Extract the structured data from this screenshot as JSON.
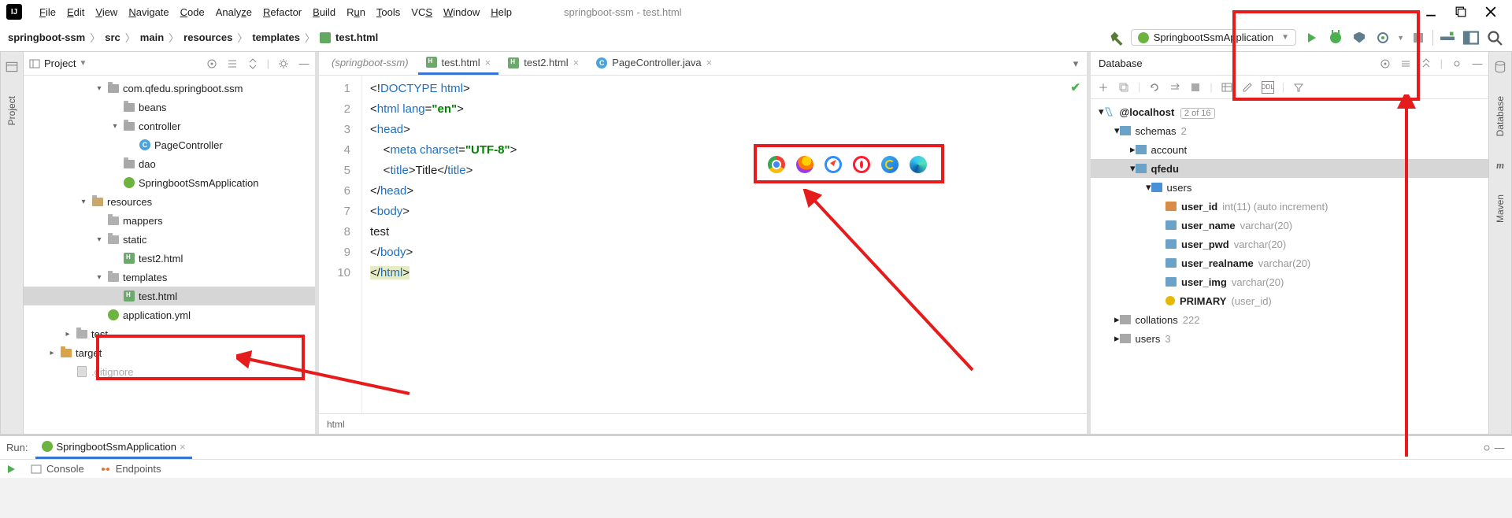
{
  "window": {
    "title": "springboot-ssm - test.html",
    "menus": [
      {
        "u": "F",
        "rest": "ile"
      },
      {
        "u": "E",
        "rest": "dit"
      },
      {
        "u": "V",
        "rest": "iew"
      },
      {
        "u": "N",
        "rest": "avigate"
      },
      {
        "u": "C",
        "rest": "ode"
      },
      {
        "u": "",
        "rest": "Analyze"
      },
      {
        "u": "R",
        "rest": "efactor"
      },
      {
        "u": "B",
        "rest": "uild"
      },
      {
        "u": "",
        "rest": "R"
      },
      {
        "u": "T",
        "rest": "ools"
      },
      {
        "u": "",
        "rest": "VCS"
      },
      {
        "u": "W",
        "rest": "indow"
      },
      {
        "u": "H",
        "rest": "elp"
      }
    ],
    "menus_raw": [
      "File",
      "Edit",
      "View",
      "Navigate",
      "Code",
      "Analyze",
      "Refactor",
      "Build",
      "Run",
      "Tools",
      "VCS",
      "Window",
      "Help"
    ]
  },
  "breadcrumb": [
    "springboot-ssm",
    "src",
    "main",
    "resources",
    "templates",
    "test.html"
  ],
  "runconfig_label": "SpringbootSsmApplication",
  "project_panel": {
    "title": "Project"
  },
  "tree": [
    {
      "ind": 90,
      "chev": "▾",
      "icon": "pkg",
      "label": "com.qfedu.springboot.ssm"
    },
    {
      "ind": 110,
      "chev": "",
      "icon": "pkg",
      "label": "beans"
    },
    {
      "ind": 110,
      "chev": "▾",
      "icon": "pkg",
      "label": "controller"
    },
    {
      "ind": 130,
      "chev": "",
      "icon": "cls",
      "label": "PageController"
    },
    {
      "ind": 110,
      "chev": "",
      "icon": "pkg",
      "label": "dao"
    },
    {
      "ind": 110,
      "chev": "",
      "icon": "leaf",
      "label": "SpringbootSsmApplication"
    },
    {
      "ind": 70,
      "chev": "▾",
      "icon": "res",
      "label": "resources"
    },
    {
      "ind": 90,
      "chev": "",
      "icon": "folder",
      "label": "mappers"
    },
    {
      "ind": 90,
      "chev": "▾",
      "icon": "folder",
      "label": "static"
    },
    {
      "ind": 110,
      "chev": "",
      "icon": "html",
      "label": "test2.html"
    },
    {
      "ind": 90,
      "chev": "▾",
      "icon": "folder",
      "label": "templates",
      "boxed": true
    },
    {
      "ind": 110,
      "chev": "",
      "icon": "html",
      "label": "test.html",
      "sel": true,
      "boxed": true
    },
    {
      "ind": 90,
      "chev": "",
      "icon": "yml",
      "label": "application.yml"
    },
    {
      "ind": 50,
      "chev": "▸",
      "icon": "folder",
      "label": "test"
    },
    {
      "ind": 30,
      "chev": "▸",
      "icon": "orange",
      "label": "target"
    },
    {
      "ind": 50,
      "chev": "",
      "icon": "file",
      "label": ".gitignore",
      "faded": true
    }
  ],
  "editor": {
    "tabs": [
      {
        "label": "(springboot-ssm)",
        "italic": true
      },
      {
        "label": "test.html",
        "icon": "html",
        "active": true,
        "close": true
      },
      {
        "label": "test2.html",
        "icon": "html",
        "close": true
      },
      {
        "label": "PageController.java",
        "icon": "cls",
        "close": true
      }
    ],
    "lines": [
      1,
      2,
      3,
      4,
      5,
      6,
      7,
      8,
      9,
      10
    ],
    "status_path": "html"
  },
  "database": {
    "title": "Database",
    "root": "@localhost",
    "root_badge": "2 of 16",
    "schemas_label": "schemas",
    "schemas_count": "2",
    "account": "account",
    "qfedu": "qfedu",
    "users": "users",
    "cols": [
      {
        "name": "user_id",
        "type": "int(11) (auto increment)",
        "key": true
      },
      {
        "name": "user_name",
        "type": "varchar(20)"
      },
      {
        "name": "user_pwd",
        "type": "varchar(20)"
      },
      {
        "name": "user_realname",
        "type": "varchar(20)"
      },
      {
        "name": "user_img",
        "type": "varchar(20)"
      }
    ],
    "primary": "PRIMARY",
    "primary_cols": "(user_id)",
    "collations": "collations",
    "collations_n": "222",
    "users2": "users",
    "users2_n": "3"
  },
  "run": {
    "label": "Run:",
    "tab": "SpringbootSsmApplication",
    "console": "Console",
    "endpoints": "Endpoints"
  },
  "left_stripe": {
    "project": "Project"
  },
  "right_stripe": {
    "database": "Database",
    "maven": "Maven"
  }
}
